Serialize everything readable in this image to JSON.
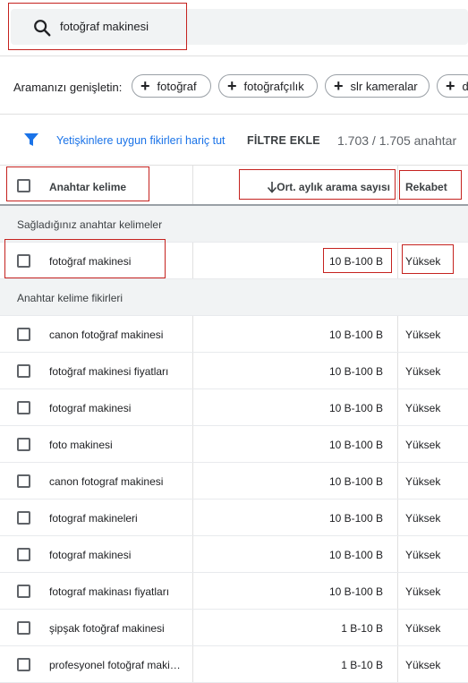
{
  "search": {
    "query": "fotoğraf makinesi"
  },
  "broaden": {
    "label": "Aramanızı genişletin:",
    "chips": [
      "fotoğraf",
      "fotoğrafçılık",
      "slr kameralar",
      "d"
    ]
  },
  "filter": {
    "exclude_adult": "Yetişkinlere uygun fikirleri hariç tut",
    "add_filter": "FİLTRE EKLE",
    "count": "1.703 / 1.705 anahtar"
  },
  "table": {
    "headers": {
      "keyword": "Anahtar kelime",
      "volume": "Ort. aylık arama sayısı",
      "competition": "Rekabet"
    },
    "sections": {
      "provided": "Sağladığınız anahtar kelimeler",
      "ideas": "Anahtar kelime fikirleri"
    },
    "provided_rows": [
      {
        "keyword": "fotoğraf makinesi",
        "volume": "10 B-100 B",
        "competition": "Yüksek"
      }
    ],
    "idea_rows": [
      {
        "keyword": "canon fotoğraf makinesi",
        "volume": "10 B-100 B",
        "competition": "Yüksek"
      },
      {
        "keyword": "fotoğraf makinesi fiyatları",
        "volume": "10 B-100 B",
        "competition": "Yüksek"
      },
      {
        "keyword": "fotograf makinesi",
        "volume": "10 B-100 B",
        "competition": "Yüksek"
      },
      {
        "keyword": "foto makinesi",
        "volume": "10 B-100 B",
        "competition": "Yüksek"
      },
      {
        "keyword": "canon fotograf makinesi",
        "volume": "10 B-100 B",
        "competition": "Yüksek"
      },
      {
        "keyword": "fotograf makineleri",
        "volume": "10 B-100 B",
        "competition": "Yüksek"
      },
      {
        "keyword": "fotograf makinesi",
        "volume": "10 B-100 B",
        "competition": "Yüksek"
      },
      {
        "keyword": "fotograf makinası fiyatları",
        "volume": "10 B-100 B",
        "competition": "Yüksek"
      },
      {
        "keyword": "şipşak fotoğraf makinesi",
        "volume": "1 B-10 B",
        "competition": "Yüksek"
      },
      {
        "keyword": "profesyonel fotoğraf makinesi",
        "volume": "1 B-10 B",
        "competition": "Yüksek"
      }
    ]
  },
  "colors": {
    "highlight": "#c5221f",
    "link": "#1a73e8",
    "section_bg": "#f1f3f4"
  }
}
